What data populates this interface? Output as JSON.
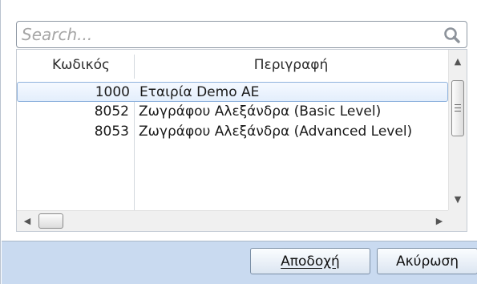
{
  "search": {
    "placeholder": "Search..."
  },
  "table": {
    "columns": [
      "Κωδικός",
      "Περιγραφή"
    ],
    "rows": [
      {
        "code": "1000",
        "description": "Εταιρία Demo AE",
        "selected": true
      },
      {
        "code": "8052",
        "description": "Ζωγράφου Αλεξάνδρα (Basic Level)"
      },
      {
        "code": "8053",
        "description": "Ζωγράφου Αλεξάνδρα (Advanced Level)"
      }
    ]
  },
  "icons": {
    "search": "search-icon",
    "scroll_up": "chevron-up-icon",
    "scroll_down": "chevron-down-icon",
    "scroll_left": "chevron-left-icon",
    "scroll_right": "chevron-right-icon"
  },
  "footer": {
    "ok_label": "Αποδοχή",
    "cancel_label": "Ακύρωση"
  },
  "colors": {
    "footer_bg": "#c9daf0",
    "selection_border": "#8fb3dd"
  }
}
